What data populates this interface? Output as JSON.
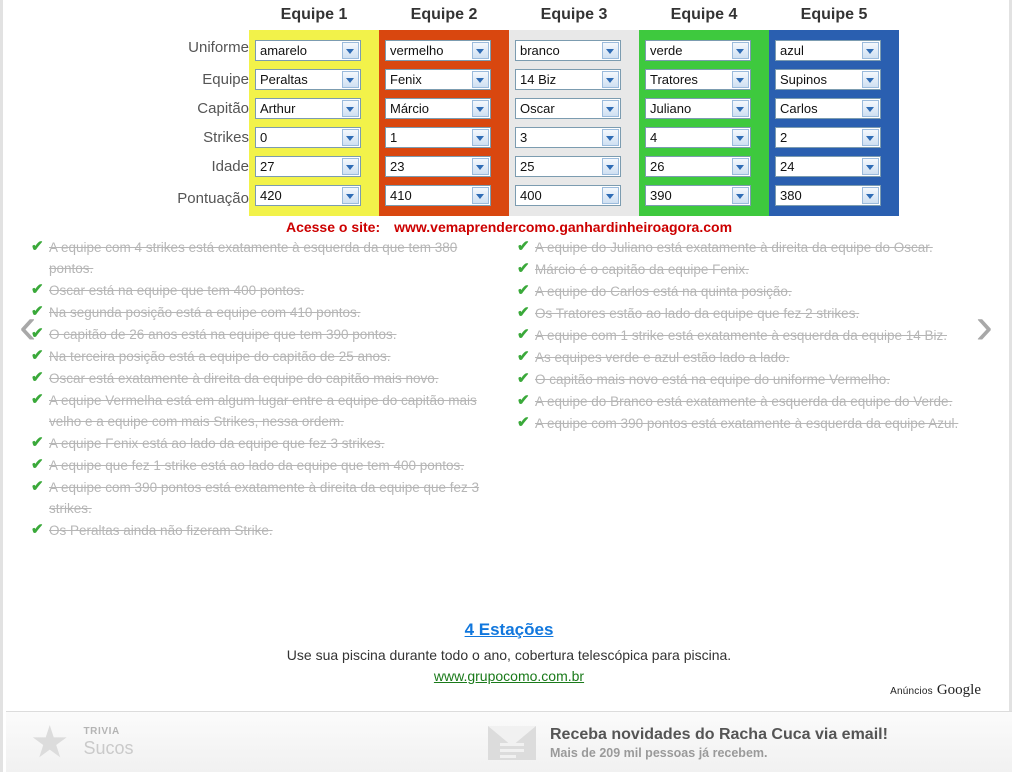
{
  "puzzle": {
    "row_labels": [
      "Uniforme",
      "Equipe",
      "Capitão",
      "Strikes",
      "Idade",
      "Pontuação"
    ],
    "columns": [
      {
        "header": "Equipe 1",
        "color": "#f2f24a",
        "values": [
          "amarelo",
          "Peraltas",
          "Arthur",
          "0",
          "27",
          "420"
        ]
      },
      {
        "header": "Equipe 2",
        "color": "#d9470f",
        "values": [
          "vermelho",
          "Fenix",
          "Márcio",
          "1",
          "23",
          "410"
        ]
      },
      {
        "header": "Equipe 3",
        "color": "#e8e8e8",
        "values": [
          "branco",
          "14 Biz",
          "Oscar",
          "3",
          "25",
          "400"
        ]
      },
      {
        "header": "Equipe 4",
        "color": "#3ec93e",
        "values": [
          "verde",
          "Tratores",
          "Juliano",
          "4",
          "26",
          "390"
        ]
      },
      {
        "header": "Equipe 5",
        "color": "#2a5fb0",
        "values": [
          "azul",
          "Supinos",
          "Carlos",
          "2",
          "24",
          "380"
        ]
      }
    ]
  },
  "site_line": {
    "label": "Acesse o site:",
    "url": "www.vemaprendercomo.ganhardinheiroagora.com",
    "color": "#cc0000"
  },
  "clues": {
    "tick": "✔",
    "left": [
      "A equipe com 4 strikes está exatamente à esquerda da que tem 380 pontos.",
      "Oscar está na equipe que tem 400 pontos.",
      "Na segunda posição está a equipe com 410 pontos.",
      "O capitão de 26 anos está na equipe que tem 390 pontos.",
      "Na terceira posição está a equipe do capitão de 25 anos.",
      "Oscar está exatamente à direita da equipe do capitão mais novo.",
      "A equipe Vermelha está em algum lugar entre a equipe do capitão mais velho e a equipe com mais Strikes, nessa ordem.",
      "A equipe Fenix está ao lado da equipe que fez 3 strikes.",
      "A equipe que fez 1 strike está ao lado da equipe que tem 400 pontos.",
      "A equipe com 390 pontos está exatamente à direita da equipe que fez 3 strikes.",
      "Os Peraltas ainda não fizeram Strike."
    ],
    "right": [
      "A equipe do Juliano está exatamente à direita da equipe do Oscar.",
      "Márcio é o capitão da equipe Fenix.",
      "A equipe do Carlos está na quinta posição.",
      "Os Tratores estão ao lado da equipe que fez 2 strikes.",
      "A equipe com 1 strike está exatamente à esquerda da equipe 14 Biz.",
      "As equipes verde e azul estão lado a lado.",
      "O capitão mais novo está na equipe do uniforme Vermelho.",
      "A equipe do Branco está exatamente à esquerda da equipe do Verde.",
      "A equipe com 390 pontos está exatamente à esquerda da equipe Azul."
    ]
  },
  "nav": {
    "prev": "‹",
    "next": "›"
  },
  "bottom_ad": {
    "title": "4 Estações",
    "description": "Use sua piscina durante todo o ano, cobertura telescópica para piscina.",
    "url": "www.grupocomo.com.br",
    "ads_label_1": "Anúncios",
    "ads_label_2": "Google"
  },
  "footer": {
    "trivia": {
      "kicker": "TRIVIA",
      "title": "Sucos",
      "icon": "star-icon"
    },
    "newsletter": {
      "title": "Receba novidades do Racha Cuca via email!",
      "subtitle": "Mais de 209 mil pessoas já recebem.",
      "icon": "envelope-icon"
    }
  }
}
